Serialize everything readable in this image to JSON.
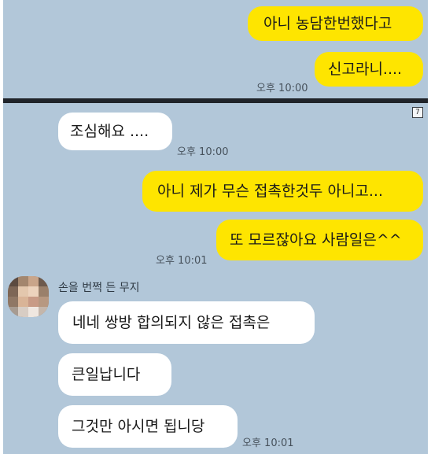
{
  "top_section": {
    "messages": [
      {
        "text": "아니 농담한번했다고"
      },
      {
        "text": "신고라니...."
      }
    ],
    "time": "오후 10:00"
  },
  "bottom_section": {
    "badge": "7",
    "first_other": {
      "text": "조심해요 ....",
      "time": "오후 10:00"
    },
    "my_messages": [
      {
        "text": "아니 제가 무슨 접촉한것두 아니고..."
      },
      {
        "text": "또 모르잖아요 사람일은^^"
      }
    ],
    "my_time": "오후 10:01",
    "sender_name": "손을 번쩍 든 무지",
    "replies": [
      {
        "text": "네네 쌍방 합의되지 않은 접촉은"
      },
      {
        "text": "큰일납니다"
      },
      {
        "text": "그것만 아시면 됩니당"
      }
    ],
    "reply_time": "오후 10:01"
  },
  "colors": {
    "chat_background": "#b2c7d9",
    "my_bubble": "#fee500",
    "other_bubble": "#ffffff",
    "divider": "#20242a"
  }
}
